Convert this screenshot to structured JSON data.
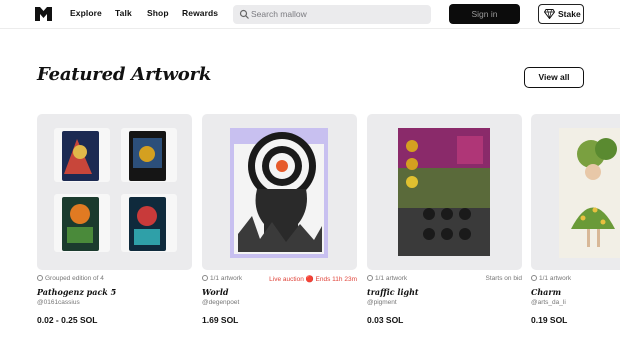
{
  "nav": {
    "links": [
      "Explore",
      "Talk",
      "Shop",
      "Rewards"
    ],
    "search_placeholder": "Search mallow",
    "signin_label": "Sign in",
    "stake_label": "Stake"
  },
  "section": {
    "title": "Featured Artwork",
    "view_all_label": "View all"
  },
  "cards": [
    {
      "type_label": "Grouped edition of 4",
      "right_label": "",
      "title": "Pathogenz pack 5",
      "handle": "@0161cassius",
      "price": "0.02 - 0.25 SOL"
    },
    {
      "type_label": "1/1 artwork",
      "right_label": "Live auction 🔴 Ends 11h 23m",
      "title": "World",
      "handle": "@degenpoet",
      "price": "1.69 SOL"
    },
    {
      "type_label": "1/1 artwork",
      "right_label": "Starts on bid",
      "title": "traffic light",
      "handle": "@pigment",
      "price": "0.03 SOL"
    },
    {
      "type_label": "1/1 artwork",
      "right_label": "",
      "title": "Charm",
      "handle": "@arts_da_li",
      "price": "0.19 SOL"
    }
  ],
  "colors": {
    "accent_live": "#e0443a",
    "card_bg": "#ebebed",
    "signin_bg": "#0c0c0c"
  }
}
